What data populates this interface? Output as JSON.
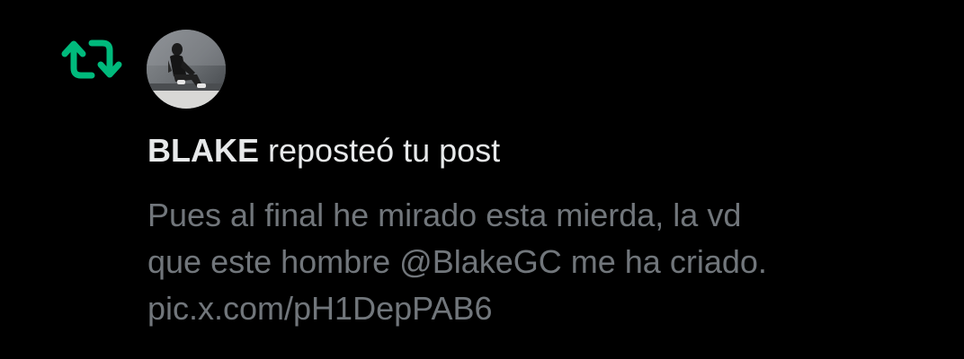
{
  "notification": {
    "type_icon": "repost-icon",
    "accent_color": "#00ba7c",
    "user_name": "BLAKE",
    "action_text": "reposteó tu post",
    "post_lines": [
      "Pues al final he mirado esta mierda, la vd",
      "que este hombre @BlakeGC me ha criado.",
      "pic.x.com/pH1DepPAB6"
    ]
  }
}
